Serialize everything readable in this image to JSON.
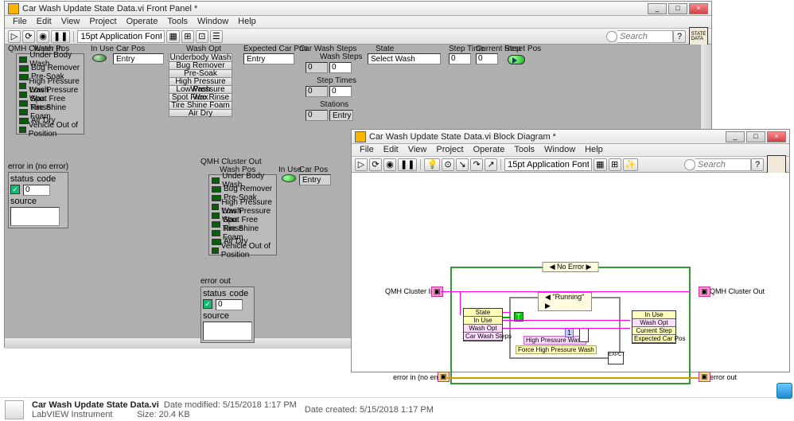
{
  "front": {
    "title": "Car Wash Update State Data.vi Front Panel *",
    "menus": [
      "File",
      "Edit",
      "View",
      "Project",
      "Operate",
      "Tools",
      "Window",
      "Help"
    ],
    "font": "15pt Application Font",
    "search": "Search",
    "cluster_in_label": "QMH Cluster In",
    "cluster_out_label": "QMH Cluster Out",
    "washpos_label": "Wash Pos",
    "inuse_label": "In Use",
    "carpos_label": "Car Pos",
    "carpos_value": "Entry",
    "washopt_label": "Wash Opt",
    "expected_label": "Expected Car Pos",
    "expected_value": "Entry",
    "carwashsteps_label": "Car Wash Steps",
    "washsteps_label": "Wash Steps",
    "washsteps_value": "0",
    "steptimes_label": "Step Times",
    "steptimes_value": "0",
    "stations_label": "Stations",
    "stations_value": "0",
    "stations_text": "Entry",
    "state_label": "State",
    "state_value": "Select Wash",
    "steptime_label": "Step Time",
    "steptime_value": "0",
    "currentstep_label": "Current Step",
    "currentstep_value": "0",
    "resetpos_label": "Reset Pos",
    "washpos_items": [
      "Under Body Wash",
      "Bug Remover",
      "Pre-Soak",
      "High Pressure Wash",
      "Low Pressure Wax",
      "Spot Free Rinse",
      "Tire Shine Foam",
      "Air Dry",
      "Vehicle Out of Position"
    ],
    "washopt_items": [
      "Underbody Wash",
      "Bug Remover",
      "Pre-Soak",
      "High Pressure Wash",
      "Low Pressure Wax",
      "Spot Free Rinse",
      "Tire Shine Foam",
      "Air Dry"
    ],
    "errin_label": "error in (no error)",
    "errout_label": "error out",
    "err_status": "status",
    "err_code": "code",
    "err_code_value": "0",
    "err_source": "source"
  },
  "block": {
    "title": "Car Wash Update State Data.vi Block Diagram *",
    "menus": [
      "File",
      "Edit",
      "View",
      "Project",
      "Operate",
      "Tools",
      "Window",
      "Help"
    ],
    "font": "15pt Application Font",
    "search": "Search",
    "case_outer": "◀ No Error ▶",
    "case_inner": "◀ \"Running\" ▶",
    "qmh_in": "QMH Cluster In",
    "qmh_out": "QMH Cluster Out",
    "errin": "error in (no error)",
    "errout": "error out",
    "unbundle": [
      "State",
      "In Use",
      "Wash Opt",
      "Car Wash Steps"
    ],
    "bundle": [
      "In Use",
      "Wash Opt",
      "Current Step",
      "Expected Car Pos"
    ],
    "const1": "High Pressure Wash",
    "const2": "Force High Pressure Wash"
  },
  "explorer": {
    "filename": "Car Wash Update State Data.vi",
    "type": "LabVIEW Instrument",
    "modified_label": "Date modified:",
    "modified": "5/15/2018 1:17 PM",
    "size_label": "Size:",
    "size": "20.4 KB",
    "created_label": "Date created:",
    "created": "5/15/2018 1:17 PM"
  }
}
